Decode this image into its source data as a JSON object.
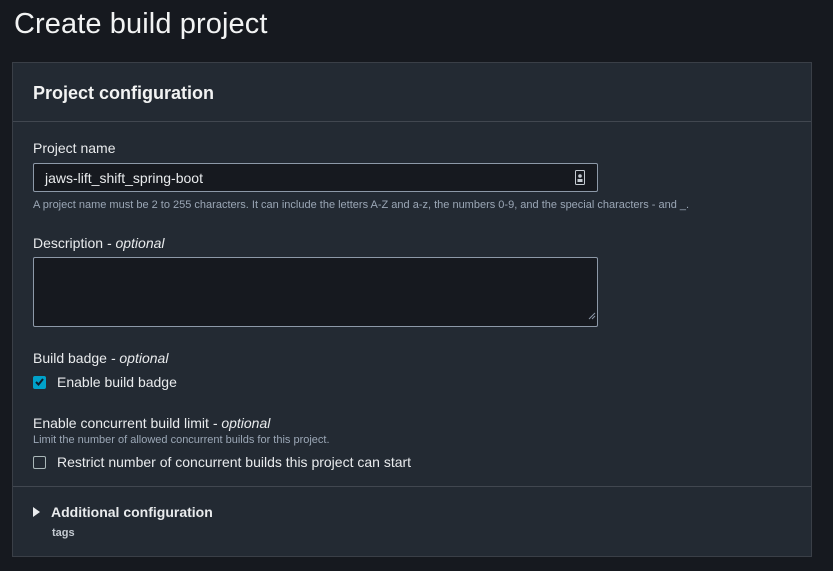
{
  "page": {
    "title": "Create build project"
  },
  "panel": {
    "title": "Project configuration",
    "project_name": {
      "label": "Project name",
      "value": "jaws-lift_shift_spring-boot",
      "hint": "A project name must be 2 to 255 characters. It can include the letters A-Z and a-z, the numbers 0-9, and the special characters - and _."
    },
    "description": {
      "label": "Description",
      "optional": "- optional",
      "value": ""
    },
    "build_badge": {
      "label": "Build badge",
      "optional": "- optional",
      "checkbox_label": "Enable build badge",
      "checked": true
    },
    "concurrent_limit": {
      "label": "Enable concurrent build limit",
      "optional": "- optional",
      "hint": "Limit the number of allowed concurrent builds for this project.",
      "checkbox_label": "Restrict number of concurrent builds this project can start",
      "checked": false
    },
    "additional_config": {
      "title": "Additional configuration",
      "subtitle": "tags"
    }
  },
  "colors": {
    "accent": "#00a1c9",
    "background": "#16191f",
    "panel": "#232a33"
  }
}
